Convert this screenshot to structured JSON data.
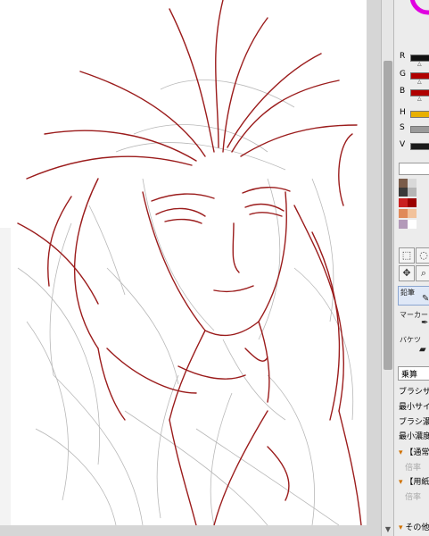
{
  "color_panel": {
    "sliders": [
      {
        "label": "R",
        "color": "#111111"
      },
      {
        "label": "G",
        "color": "#b00000"
      },
      {
        "label": "B",
        "color": "#b00000"
      },
      {
        "label": "H",
        "color": "#e8b000"
      },
      {
        "label": "S",
        "color": "#9a9a9a"
      },
      {
        "label": "V",
        "color": "#1a1a1a"
      }
    ],
    "wheel_color": "#e000e0"
  },
  "swatches": [
    "#7a5c4a",
    "#d9d9d9",
    "#3a3a3a",
    "#b5b5b5",
    "#c92020",
    "#9a0000",
    "#e08a5a",
    "#f2c29b",
    "#b39ab9",
    "#ffffff"
  ],
  "tools": {
    "pencil_label": "鉛筆",
    "marker_label": "マーカー",
    "bucket_label": "バケツ"
  },
  "brush_settings": {
    "blend_mode": "乗算",
    "brush_size_label": "ブラシサイ",
    "min_size_label": "最小サイ",
    "brush_density_label": "ブラシ濃",
    "min_density_label": "最小濃度",
    "section_normal": "【通常",
    "section_normal_field": "倍率",
    "section_paper": "【用紙",
    "section_paper_field": "倍率",
    "section_other": "その他"
  }
}
